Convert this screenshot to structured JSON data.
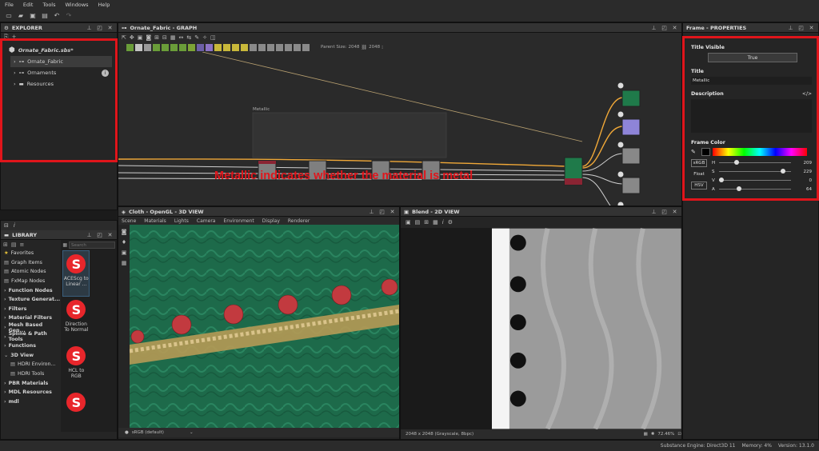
{
  "menu": [
    "File",
    "Edit",
    "Tools",
    "Windows",
    "Help"
  ],
  "explorer": {
    "title": "EXPLORER",
    "package": "Ornate_Fabric.sbs*",
    "items": [
      "Ornate_Fabric",
      "Ornaments",
      "Resources"
    ]
  },
  "graph": {
    "title": "Ornate_Fabric - GRAPH",
    "parent_size_label": "Parent Size:",
    "parent_size_value": "2048",
    "size_value": "2048",
    "frame_title": "Metallic",
    "caption": "Metallic indicates whether the material is metal"
  },
  "properties": {
    "title": "Frame - PROPERTIES",
    "title_visible_label": "Title Visible",
    "title_visible_value": "True",
    "title_label": "Title",
    "title_value": "Metallic",
    "description_label": "Description",
    "frame_color_label": "Frame Color",
    "srgb_btn": "sRGB",
    "float_btn": "Float",
    "hsv_btn": "HSV",
    "sliders": [
      {
        "label": "H",
        "value": "209",
        "fraction": 0.22
      },
      {
        "label": "S",
        "value": "229",
        "fraction": 0.9
      },
      {
        "label": "V",
        "value": "0",
        "fraction": 0.0
      },
      {
        "label": "A",
        "value": "64",
        "fraction": 0.25
      }
    ]
  },
  "library": {
    "title": "LIBRARY",
    "search_placeholder": "Search",
    "categories": [
      {
        "label": "Favorites",
        "bold": false,
        "icon": "★"
      },
      {
        "label": "Graph Items",
        "bold": false,
        "icon": "▤"
      },
      {
        "label": "Atomic Nodes",
        "bold": false,
        "icon": "▤"
      },
      {
        "label": "FxMap Nodes",
        "bold": false,
        "icon": "▤"
      },
      {
        "label": "Function Nodes",
        "bold": true,
        "icon": "›"
      },
      {
        "label": "Texture Generat...",
        "bold": true,
        "icon": "›"
      },
      {
        "label": "Filters",
        "bold": true,
        "icon": "›"
      },
      {
        "label": "Material Filters",
        "bold": true,
        "icon": "›"
      },
      {
        "label": "Mesh Based Gen...",
        "bold": true,
        "icon": "›"
      },
      {
        "label": "Spline & Path Tools",
        "bold": true,
        "icon": "›"
      },
      {
        "label": "Functions",
        "bold": true,
        "icon": "›"
      },
      {
        "label": "3D View",
        "bold": true,
        "icon": "⌄"
      },
      {
        "label": "HDRI Environ...",
        "bold": false,
        "icon": "▤"
      },
      {
        "label": "HDRI Tools",
        "bold": false,
        "icon": "▤"
      },
      {
        "label": "PBR Materials",
        "bold": true,
        "icon": "›"
      },
      {
        "label": "MDL Resources",
        "bold": true,
        "icon": "›"
      },
      {
        "label": "mdl",
        "bold": true,
        "icon": "›"
      }
    ],
    "tiles": [
      "ACEScg to Linear ...",
      "Direction To Normal",
      "HCL to RGB",
      ""
    ]
  },
  "view3d": {
    "title": "Cloth - OpenGL - 3D VIEW",
    "menu": [
      "Scene",
      "Materials",
      "Lights",
      "Camera",
      "Environment",
      "Display",
      "Renderer"
    ],
    "colorspace": "sRGB (default)"
  },
  "view2d": {
    "title": "Blend - 2D VIEW",
    "info": "2048 x 2048 (Grayscale, 8bpc)",
    "zoom": "72.46%"
  },
  "status": {
    "engine": "Substance Engine: Direct3D 11",
    "memory": "Memory: 4%",
    "version": "Version: 13.1.0"
  },
  "colors": {
    "highlight_red": "#e0151b",
    "wire_orange": "#f0a838",
    "node_green": "#1f7a4a",
    "node_purple": "#8e84d8"
  }
}
